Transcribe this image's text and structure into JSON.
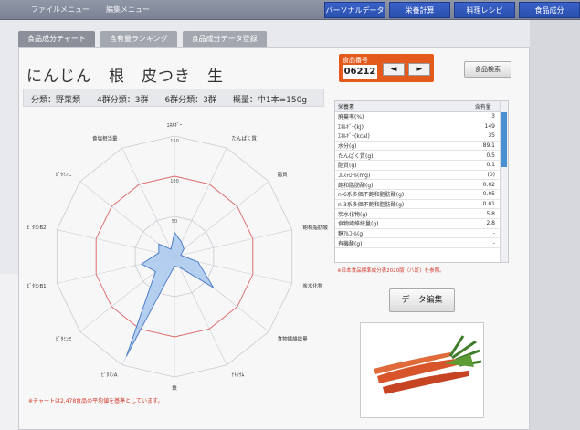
{
  "menubar": {
    "left": [
      "ファイルメニュー",
      "編集メニュー"
    ],
    "right": [
      "パーソナルデータ",
      "栄養計算",
      "料理レシピ",
      "食品成分"
    ]
  },
  "tabs": [
    "食品成分チャート",
    "含有量ランキング",
    "食品成分データ登録"
  ],
  "food": {
    "title": "にんじん　根　皮つき　生",
    "meta": "分類：野菜類　　4群分類：3群　　6群分類：3群　　概量：中1本=150g",
    "number_label": "食品番号",
    "number": "06212",
    "prev_label": "◄",
    "next_label": "►"
  },
  "buttons": {
    "search": "食品検索",
    "edit": "データ編集"
  },
  "notes": {
    "chart": "※チャートは2,478食品の平均値を基準としています。",
    "table": "※日本食品標準成分表2020版（八訂）を参照。"
  },
  "table": {
    "headers": [
      "栄養素",
      "含有量"
    ],
    "rows": [
      [
        "廃棄率(%)",
        "3"
      ],
      [
        "ｴﾈﾙｷﾞｰ(kJ)",
        "149"
      ],
      [
        "ｴﾈﾙｷﾞｰ(kcal)",
        "35"
      ],
      [
        "水分(g)",
        "89.1"
      ],
      [
        "たんぱく質(g)",
        "0.5"
      ],
      [
        "脂質(g)",
        "0.1"
      ],
      [
        "ｺﾚｽﾃﾛｰﾙ(mg)",
        "(0)"
      ],
      [
        "飽和脂肪酸(g)",
        "0.02"
      ],
      [
        "n-6系多価不飽和脂肪酸(g)",
        "0.05"
      ],
      [
        "n-3系多価不飽和脂肪酸(g)",
        "0.01"
      ],
      [
        "炭水化物(g)",
        "5.8"
      ],
      [
        "食物繊維総量(g)",
        "2.8"
      ],
      [
        "糖ｱﾙｺｰﾙ(g)",
        "-"
      ],
      [
        "有機酸(g)",
        "-"
      ]
    ]
  },
  "chart_data": {
    "type": "radar",
    "axes": [
      "ｴﾈﾙｷﾞｰ",
      "たんぱく質",
      "脂質",
      "飽和脂肪酸",
      "炭水化物",
      "食物繊維総量",
      "ﾅﾄﾘｳﾑ",
      "鉄",
      "ﾋﾞﾀﾐﾝA",
      "ﾋﾞﾀﾐﾝE",
      "ﾋﾞﾀﾐﾝB1",
      "ﾋﾞﾀﾐﾝB2",
      "ﾋﾞﾀﾐﾝC",
      "食塩相当量"
    ],
    "ticks": [
      "150",
      "100",
      "50"
    ],
    "max": 150,
    "reference": 100,
    "values": [
      30,
      20,
      15,
      8,
      30,
      62,
      15,
      12,
      138,
      30,
      42,
      20,
      25,
      10
    ],
    "colors": {
      "fill": "#a9c8ee",
      "stroke": "#4f80c8",
      "reference": "#e06a6a",
      "grid": "#c8cad0"
    }
  }
}
